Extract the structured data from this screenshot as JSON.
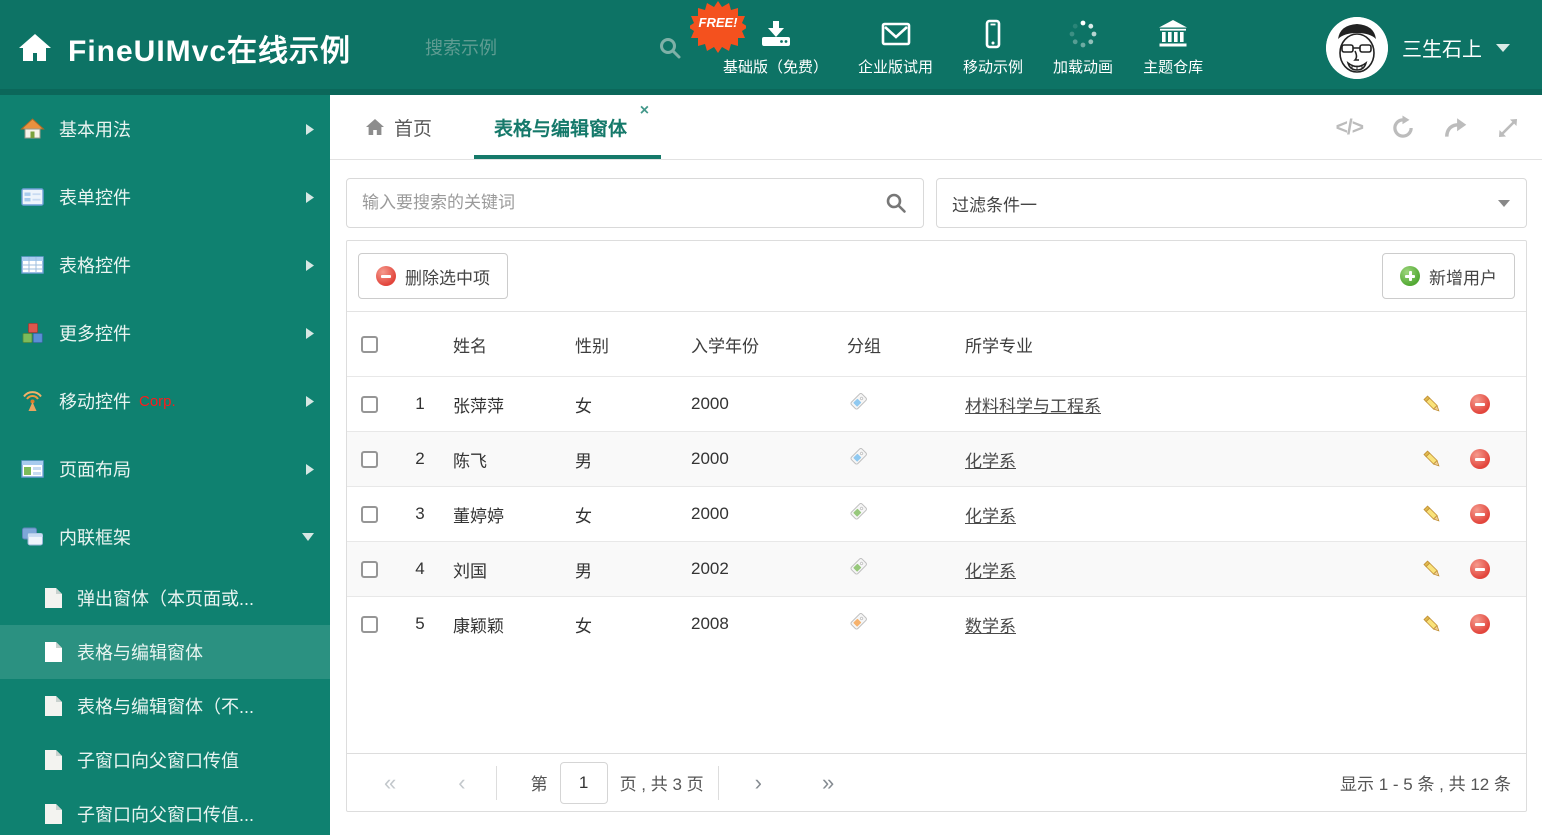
{
  "theme": {
    "header_bg": "#0d7365",
    "sidebar_bg": "#0f8170",
    "sidebar_active_bg": "#2b9181",
    "accent": "#15796a",
    "free_badge": "#f4511e",
    "danger": "#e2453c",
    "success": "#53a934",
    "tag_colors": {
      "blue": "#90c9f0",
      "green": "#97c87c",
      "orange": "#f6b26d"
    }
  },
  "header": {
    "logo_text": "FineUIMvc在线示例",
    "logo_icon": "home-icon",
    "search_placeholder": "搜索示例",
    "search_icon": "search-icon",
    "free_badge": "FREE!",
    "nav_items": [
      {
        "label": "基础版（免费）",
        "icon": "download-icon"
      },
      {
        "label": "企业版试用",
        "icon": "envelope-icon"
      },
      {
        "label": "移动示例",
        "icon": "mobile-icon"
      },
      {
        "label": "加载动画",
        "icon": "spinner-icon"
      },
      {
        "label": "主题仓库",
        "icon": "bank-icon"
      }
    ],
    "username": "三生石上"
  },
  "sidebar": {
    "items": [
      {
        "label": "基本用法",
        "icon": "home-color-icon"
      },
      {
        "label": "表单控件",
        "icon": "form-icon"
      },
      {
        "label": "表格控件",
        "icon": "table-icon"
      },
      {
        "label": "更多控件",
        "icon": "cubes-icon"
      },
      {
        "label": "移动控件",
        "badge": "Corp.",
        "icon": "antenna-icon"
      },
      {
        "label": "页面布局",
        "icon": "layout-icon"
      },
      {
        "label": "内联框架",
        "icon": "frames-icon",
        "expanded": true
      }
    ],
    "subitems": [
      {
        "label": "弹出窗体（本页面或..."
      },
      {
        "label": "表格与编辑窗体",
        "active": true
      },
      {
        "label": "表格与编辑窗体（不..."
      },
      {
        "label": "子窗口向父窗口传值"
      },
      {
        "label": "子窗口向父窗口传值..."
      }
    ]
  },
  "tabs": {
    "home_label": "首页",
    "active_label": "表格与编辑窗体",
    "close_glyph": "×"
  },
  "tab_tools": {
    "code_glyph": "</>"
  },
  "filter": {
    "search_placeholder": "输入要搜索的关键词",
    "dropdown_value": "过滤条件一"
  },
  "toolbar": {
    "delete_label": "删除选中项",
    "add_label": "新增用户"
  },
  "grid": {
    "columns": [
      "姓名",
      "性别",
      "入学年份",
      "分组",
      "所学专业"
    ],
    "rows": [
      {
        "num": "1",
        "name": "张萍萍",
        "gender": "女",
        "year": "2000",
        "tag_color": "blue",
        "major": "材料科学与工程系"
      },
      {
        "num": "2",
        "name": "陈飞",
        "gender": "男",
        "year": "2000",
        "tag_color": "blue",
        "major": "化学系"
      },
      {
        "num": "3",
        "name": "董婷婷",
        "gender": "女",
        "year": "2000",
        "tag_color": "green",
        "major": "化学系"
      },
      {
        "num": "4",
        "name": "刘国",
        "gender": "男",
        "year": "2002",
        "tag_color": "green",
        "major": "化学系"
      },
      {
        "num": "5",
        "name": "康颖颖",
        "gender": "女",
        "year": "2008",
        "tag_color": "orange",
        "major": "数学系"
      }
    ]
  },
  "pagination": {
    "first_icon": "«",
    "prev_icon": "‹",
    "next_icon": "›",
    "last_icon": "»",
    "page_prefix": "第",
    "page_value": "1",
    "page_suffix": "页 , 共 3 页",
    "info": "显示 1 - 5 条 , 共 12 条"
  }
}
